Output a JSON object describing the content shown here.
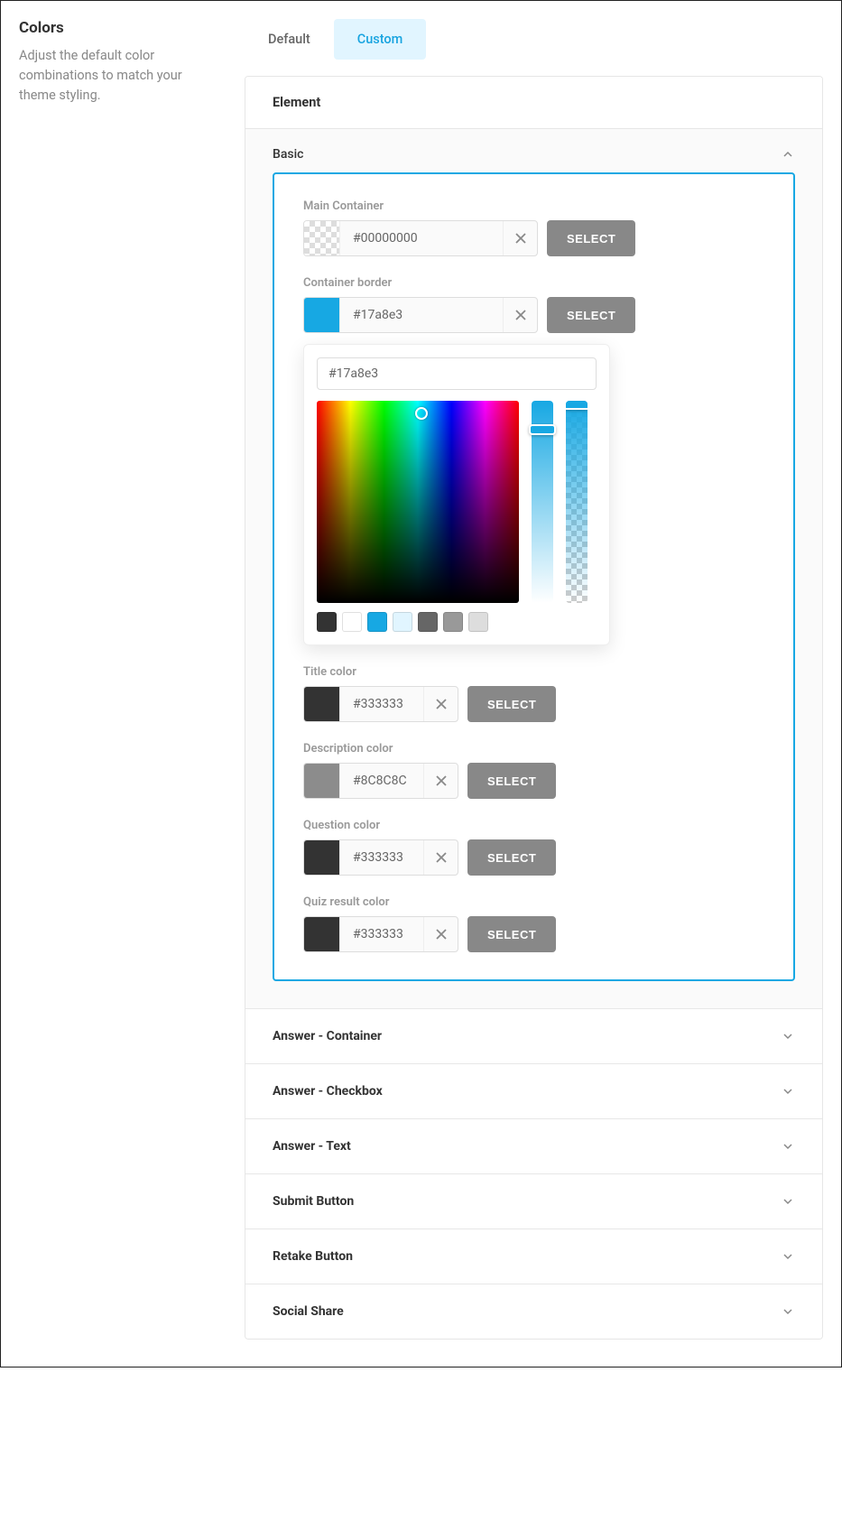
{
  "sidebar": {
    "title": "Colors",
    "description": "Adjust the default color combinations to match your theme styling."
  },
  "tabs": {
    "default": "Default",
    "custom": "Custom"
  },
  "panel": {
    "header": "Element"
  },
  "basic": {
    "title": "Basic",
    "select_label": "SELECT",
    "fields": {
      "main_container": {
        "label": "Main Container",
        "value": "#00000000",
        "swatch": "transparent"
      },
      "container_border": {
        "label": "Container border",
        "value": "#17a8e3",
        "swatch": "#17a8e3"
      },
      "title_color": {
        "label": "Title color",
        "value": "#333333",
        "swatch": "#333333"
      },
      "description_color": {
        "label": "Description color",
        "value": "#8C8C8C",
        "swatch": "#8C8C8C"
      },
      "question_color": {
        "label": "Question color",
        "value": "#333333",
        "swatch": "#333333"
      },
      "quiz_result_color": {
        "label": "Quiz result color",
        "value": "#333333",
        "swatch": "#333333"
      }
    },
    "picker": {
      "input": "#17a8e3",
      "presets": [
        "#333333",
        "#ffffff",
        "#17a8e3",
        "#e1f5ff",
        "#666666",
        "#999999",
        "#dddddd"
      ]
    }
  },
  "sections": {
    "answer_container": "Answer - Container",
    "answer_checkbox": "Answer - Checkbox",
    "answer_text": "Answer - Text",
    "submit_button": "Submit Button",
    "retake_button": "Retake Button",
    "social_share": "Social Share"
  }
}
